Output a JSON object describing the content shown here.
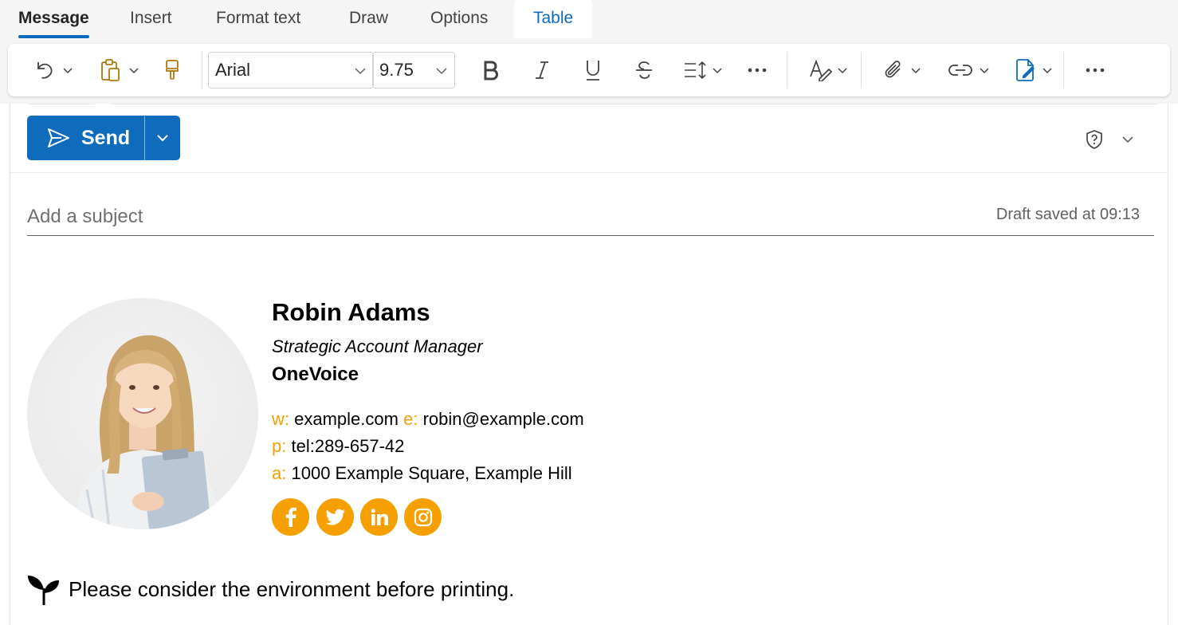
{
  "tabs": [
    {
      "label": "Message",
      "active": true
    },
    {
      "label": "Insert"
    },
    {
      "label": "Format text"
    },
    {
      "label": "Draw"
    },
    {
      "label": "Options"
    },
    {
      "label": "Table"
    }
  ],
  "ribbon": {
    "font_name": "Arial",
    "font_size": "9.75",
    "icons": [
      "undo-icon",
      "paste-icon",
      "format-painter-icon",
      "bold-icon",
      "italic-icon",
      "underline-icon",
      "strikethrough-icon",
      "paragraph-spacing-icon",
      "more-icon",
      "editor-icon",
      "attach-icon",
      "link-icon",
      "signature-icon",
      "more-icon"
    ]
  },
  "compose": {
    "send_label": "Send",
    "subject_placeholder": "Add a subject",
    "draft_status": "Draft saved at 09:13"
  },
  "signature": {
    "name": "Robin Adams",
    "title": "Strategic Account Manager",
    "company": "OneVoice",
    "website_label": "w:",
    "website": "example.com",
    "email_label": "e:",
    "email": "robin@example.com",
    "phone_label": "p:",
    "phone": "tel:289-657-42",
    "address_label": "a:",
    "address": "1000 Example Square, Example Hill",
    "social": [
      "facebook-icon",
      "twitter-icon",
      "linkedin-icon",
      "instagram-icon"
    ],
    "eco_note": "Please consider the environment before printing."
  },
  "colors": {
    "accent": "#0f6cbd",
    "signature_accent": "#f5a000"
  }
}
